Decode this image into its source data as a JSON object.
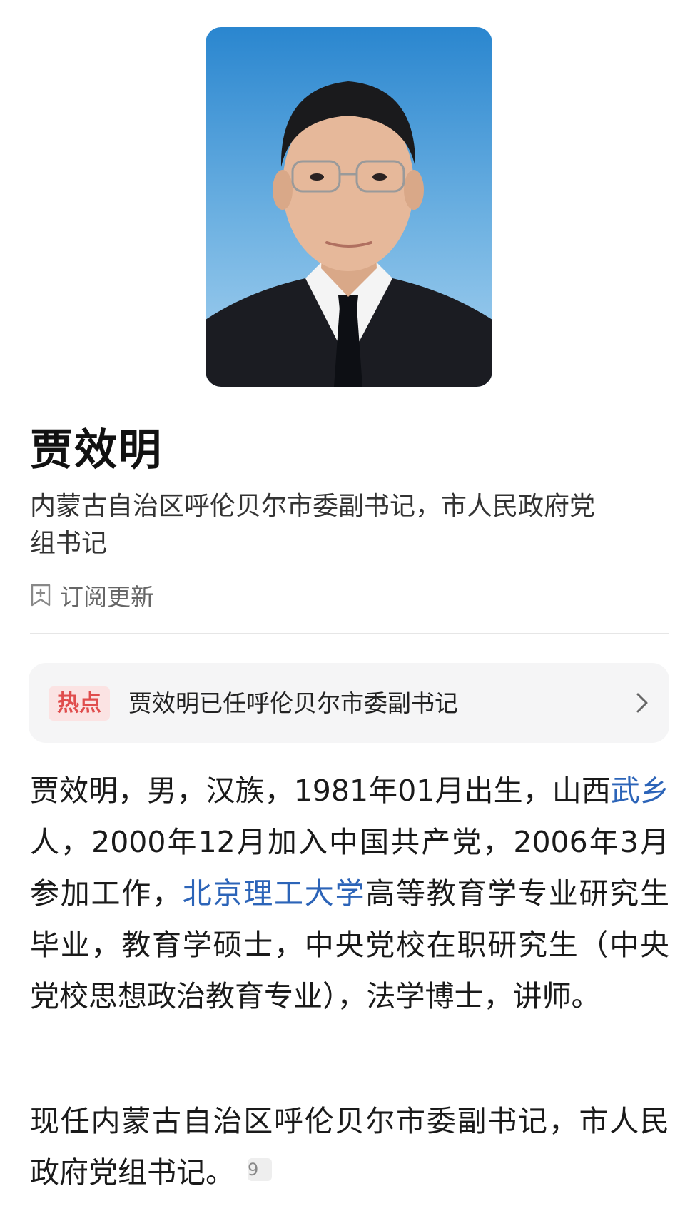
{
  "profile": {
    "photo_icon": "portrait-photo",
    "name": "贾效明",
    "title_line1": "内蒙古自治区呼伦贝尔市委副书记，市人民政府党",
    "title_line2": "组书记"
  },
  "subscribe": {
    "icon": "bookmark-plus-icon",
    "label": "订阅更新"
  },
  "hot": {
    "badge": "热点",
    "text": "贾效明已任呼伦贝尔市委副书记",
    "icon": "chevron-right-icon"
  },
  "bio": {
    "p1_a": "贾效明，男，汉族，1981年01月出生，山西",
    "p1_link1": "武乡",
    "p1_b": "人，2000年12月加入中国共产党，2006年3月参加工作，",
    "p1_link2": "北京理工大学",
    "p1_c": "高等教育学专业研究生毕业，教育学硕士，中央党校在职研究生（中央党校思想政治教育专业），法学博士，讲师。",
    "p2": "现任内蒙古自治区呼伦贝尔市委副书记，市人民政府党组书记。",
    "ref": "9"
  },
  "colors": {
    "link": "#2c64b8",
    "hot_badge_text": "#e04d4d",
    "hot_badge_bg": "#fbe3e3",
    "card_bg": "#f5f5f6"
  }
}
